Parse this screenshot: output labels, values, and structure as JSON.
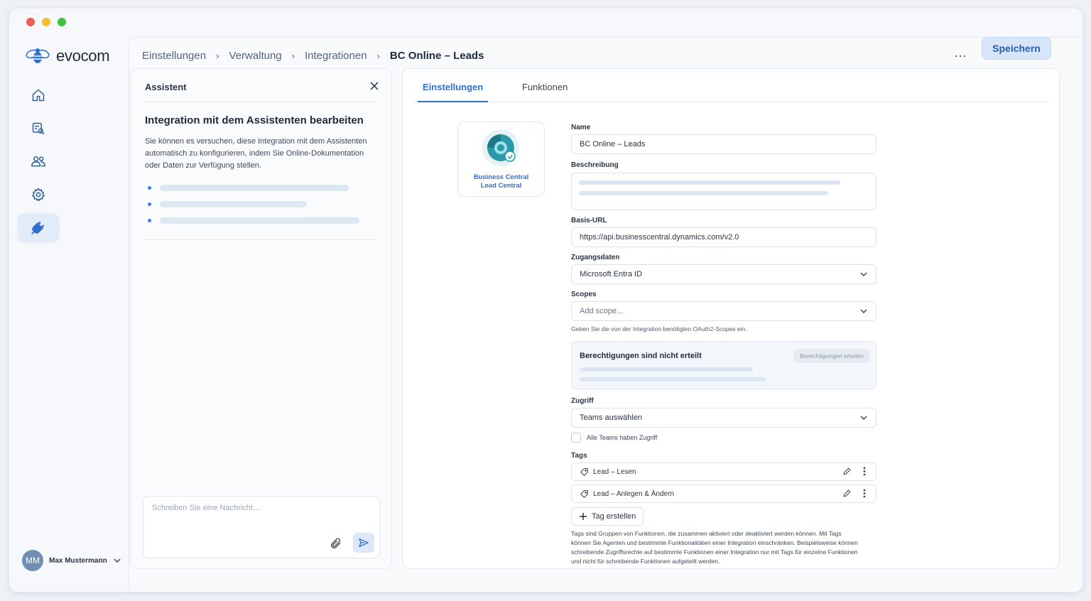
{
  "app": {
    "brand": "evocom"
  },
  "breadcrumb": [
    "Einstellungen",
    "Verwaltung",
    "Integrationen",
    "BC Online – Leads"
  ],
  "header": {
    "more_label": "···",
    "save_label": "Speichern"
  },
  "sidebar": {
    "items": [
      {
        "icon": "home-icon"
      },
      {
        "icon": "search-document-icon"
      },
      {
        "icon": "users-icon"
      },
      {
        "icon": "gear-icon"
      },
      {
        "icon": "plug-icon",
        "active": true
      }
    ],
    "user": {
      "initials": "MM",
      "name": "Max Mustermann"
    }
  },
  "assistant": {
    "header": "Assistent",
    "title": "Integration mit dem Assistenten bearbeiten",
    "text": "Sie können es versuchen, diese Integration mit dem Assistenten automatisch zu konfigurieren, indem Sie Online-Dokumentation oder Daten zur Verfügung stellen.",
    "chat_placeholder": "Schreiben Sie eine Nachricht..."
  },
  "tabs": [
    {
      "label": "Einstellungen",
      "active": true
    },
    {
      "label": "Funktionen",
      "active": false
    }
  ],
  "app_card": {
    "label_line1": "Business Central",
    "label_line2": "Lead Central"
  },
  "form": {
    "name_label": "Name",
    "name_value": "BC Online – Leads",
    "description_label": "Beschreibung",
    "base_url_label": "Basis-URL",
    "base_url_value": "https://api.businesscentral.dynamics.com/v2.0",
    "credentials_label": "Zugangsdaten",
    "credentials_value": "Microsoft Entra ID",
    "scopes_label": "Scopes",
    "scopes_placeholder": "Add scope...",
    "scopes_help": "Geben Sie die von der Integration benötigten OAuth2-Scopes ein.",
    "permissions_title": "Berechtigungen sind nicht erteilt",
    "permissions_button": "Berechtigungen erteilen",
    "access_label": "Zugriff",
    "access_value": "Teams auswählen",
    "all_teams_label": "Alle Teams haben Zugriff",
    "tags_label": "Tags",
    "tags": [
      "Lead – Lesen",
      "Lead – Anlegen & Ändern"
    ],
    "create_tag_label": "Tag erstellen",
    "tags_note": "Tags sind Gruppen von Funktionen, die zusammen aktiviert oder deaktiviert werden können. Mit Tags können Sie Agenten und bestimmte Funktionalitäten einer Integration einschränken. Beispielsweise können schreibende Zugriffsrechte auf bestimmte Funktionen einer Integration nur mit Tags für einzelne Funktionen und nicht für schreibende Funktionen aufgeteilt werden."
  },
  "colors": {
    "accent": "#2f6fcf",
    "save_bg": "#d6e6f8"
  }
}
